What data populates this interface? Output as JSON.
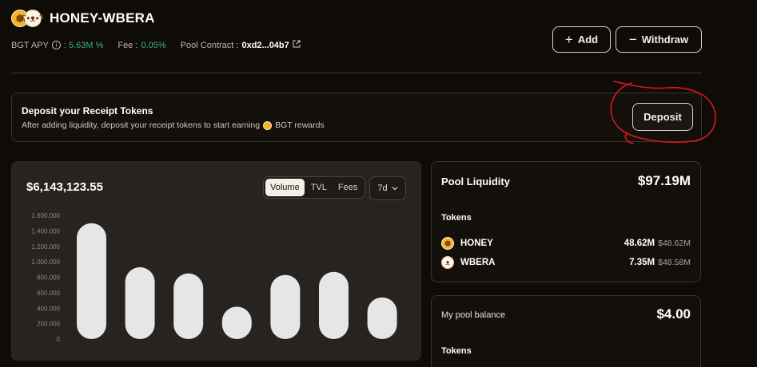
{
  "header": {
    "title": "HONEY-WBERA",
    "icons": [
      "honey-token-icon",
      "wbera-token-icon"
    ]
  },
  "meta": {
    "apy_label": "BGT APY",
    "apy_value": ": 5.63M %",
    "fee_label": "Fee :",
    "fee_value": "0.05%",
    "contract_label": "Pool Contract :",
    "contract_value": "0xd2...04b7"
  },
  "actions": {
    "add_label": "Add",
    "withdraw_label": "Withdraw"
  },
  "deposit": {
    "title": "Deposit your Receipt Tokens",
    "subtitle_before": "After adding liquidity, deposit your receipt tokens to start earning",
    "subtitle_after": "BGT rewards",
    "button_label": "Deposit",
    "annotation_color": "#e0141e"
  },
  "chart": {
    "value": "$6,143,123.55",
    "tabs": [
      {
        "label": "Volume",
        "active": true
      },
      {
        "label": "TVL",
        "active": false
      },
      {
        "label": "Fees",
        "active": false
      }
    ],
    "range": "7d"
  },
  "chart_data": {
    "type": "bar",
    "y_ticks": [
      "1.600.000",
      "1.400.000",
      "1.200.000",
      "1.000.000",
      "800.000",
      "600.000",
      "400.000",
      "200.000",
      "0"
    ],
    "ylim": [
      0,
      1600000
    ],
    "values": [
      1500000,
      930000,
      850000,
      420000,
      830000,
      870000,
      540000
    ],
    "bar_color": "#e6e6e6"
  },
  "pool": {
    "title": "Pool Liquidity",
    "total": "$97.19M",
    "tokens_label": "Tokens",
    "tokens": [
      {
        "name": "HONEY",
        "amount": "48.62M",
        "usd": "$48.62M",
        "icon": "honey-token-icon"
      },
      {
        "name": "WBERA",
        "amount": "7.35M",
        "usd": "$48.58M",
        "icon": "wbera-token-icon"
      }
    ]
  },
  "balance": {
    "title": "My pool balance",
    "total": "$4.00",
    "tokens_label": "Tokens"
  },
  "colors": {
    "background": "#0f0c08",
    "accent_green": "#3fb27f",
    "card_border": "#3a342c"
  }
}
